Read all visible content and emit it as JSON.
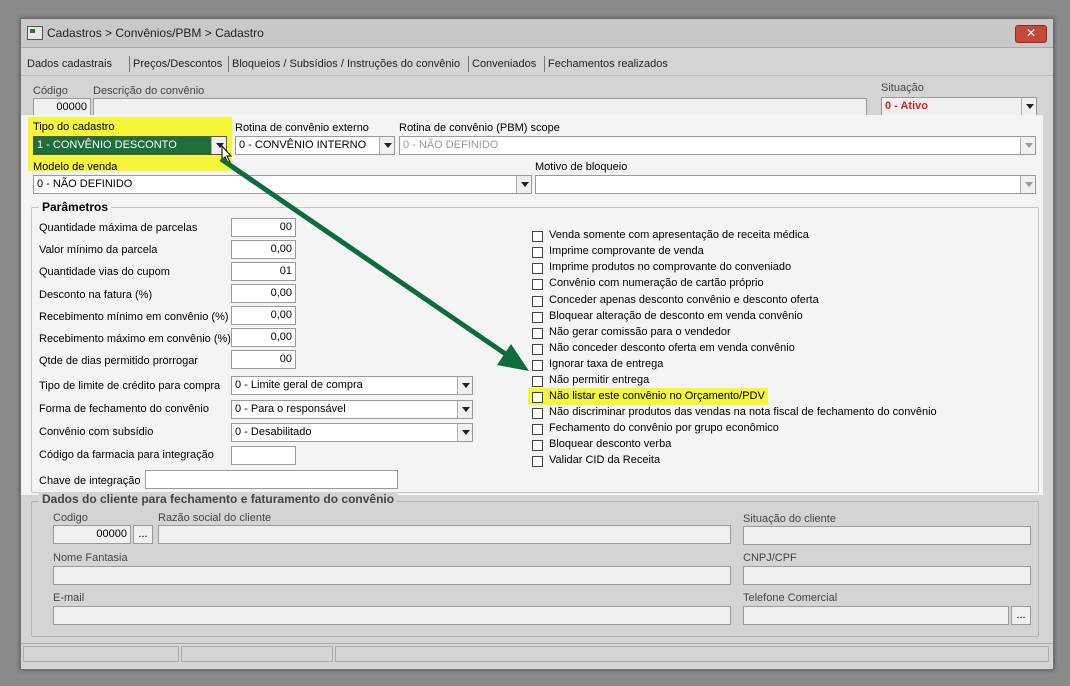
{
  "window": {
    "title": "Cadastros > Convênios/PBM > Cadastro",
    "close_label": "✕"
  },
  "tabs": [
    "Dados cadastrais",
    "Preços/Descontos",
    "Bloqueios / Subsídios / Instruções do convênio",
    "Conveniados",
    "Fechamentos realizados"
  ],
  "header": {
    "codigo_label": "Código",
    "codigo_value": "00000",
    "descricao_label": "Descrição do convênio",
    "descricao_value": "",
    "situacao_label": "Situação",
    "situacao_value": "0 - Ativo"
  },
  "form": {
    "tipo_cadastro_label": "Tipo do cadastro",
    "tipo_cadastro_value": "1 - CONVÊNIO DESCONTO",
    "rotina_externo_label": "Rotina de convênio externo",
    "rotina_externo_value": "0 - CONVÊNIO INTERNO",
    "rotina_pbm_label": "Rotina de convênio (PBM) scope",
    "rotina_pbm_value": "0 - NÃO DEFINIDO",
    "modelo_venda_label": "Modelo de venda",
    "modelo_venda_value": "0 - NÃO DEFINIDO",
    "motivo_bloqueio_label": "Motivo de bloqueio",
    "motivo_bloqueio_value": ""
  },
  "parametros": {
    "title": "Parâmetros",
    "fields": [
      {
        "label": "Quantidade máxima de parcelas",
        "value": "00"
      },
      {
        "label": "Valor mínimo da parcela",
        "value": "0,00"
      },
      {
        "label": "Quantidade vias do cupom",
        "value": "01"
      },
      {
        "label": "Desconto na fatura (%)",
        "value": "0,00"
      },
      {
        "label": "Recebimento mínimo em convênio (%)",
        "value": "0,00"
      },
      {
        "label": "Recebimento máximo em convênio (%)",
        "value": "0,00"
      },
      {
        "label": "Qtde de dias permitido prorrogar",
        "value": "00"
      }
    ],
    "selects": [
      {
        "label": "Tipo de limite de crédito para compra",
        "value": "0 - Limite geral de compra"
      },
      {
        "label": "Forma de fechamento do convênio",
        "value": "0 - Para o responsável"
      },
      {
        "label": "Convênio com subsídio",
        "value": "0 - Desabilitado"
      }
    ],
    "codigo_farmacia_label": "Código da farmacia para integração",
    "codigo_farmacia_value": "",
    "chave_integracao_label": "Chave de integração",
    "chave_integracao_value": "",
    "checkboxes": [
      "Venda somente com apresentação de receita médica",
      "Imprime comprovante de venda",
      "Imprime produtos no comprovante do conveniado",
      "Convênio com numeração de cartão próprio",
      "Conceder apenas desconto convênio e desconto oferta",
      "Bloquear alteração de desconto em venda convênio",
      "Não gerar comissão para o vendedor",
      "Não conceder desconto oferta em venda convênio",
      "Ignorar taxa de entrega",
      "Não permitir entrega",
      "Não listar este convênio no Orçamento/PDV",
      "Não discriminar produtos das vendas na nota fiscal de fechamento do convênio",
      "Fechamento do convênio por grupo econômico",
      "Bloquear desconto verba",
      "Validar CID da Receita"
    ],
    "highlight_color": "#f5f53a",
    "arrow_color": "#0e6b3f"
  },
  "cliente": {
    "title": "Dados do cliente para fechamento e faturamento do convênio",
    "codigo_label": "Codigo",
    "codigo_value": "00000",
    "lookup_label": "...",
    "razao_label": "Razão social do cliente",
    "situacao_label": "Situação do cliente",
    "fantasia_label": "Nome Fantasia",
    "cnpj_label": "CNPJ/CPF",
    "email_label": "E-mail",
    "telefone_label": "Telefone Comercial"
  }
}
